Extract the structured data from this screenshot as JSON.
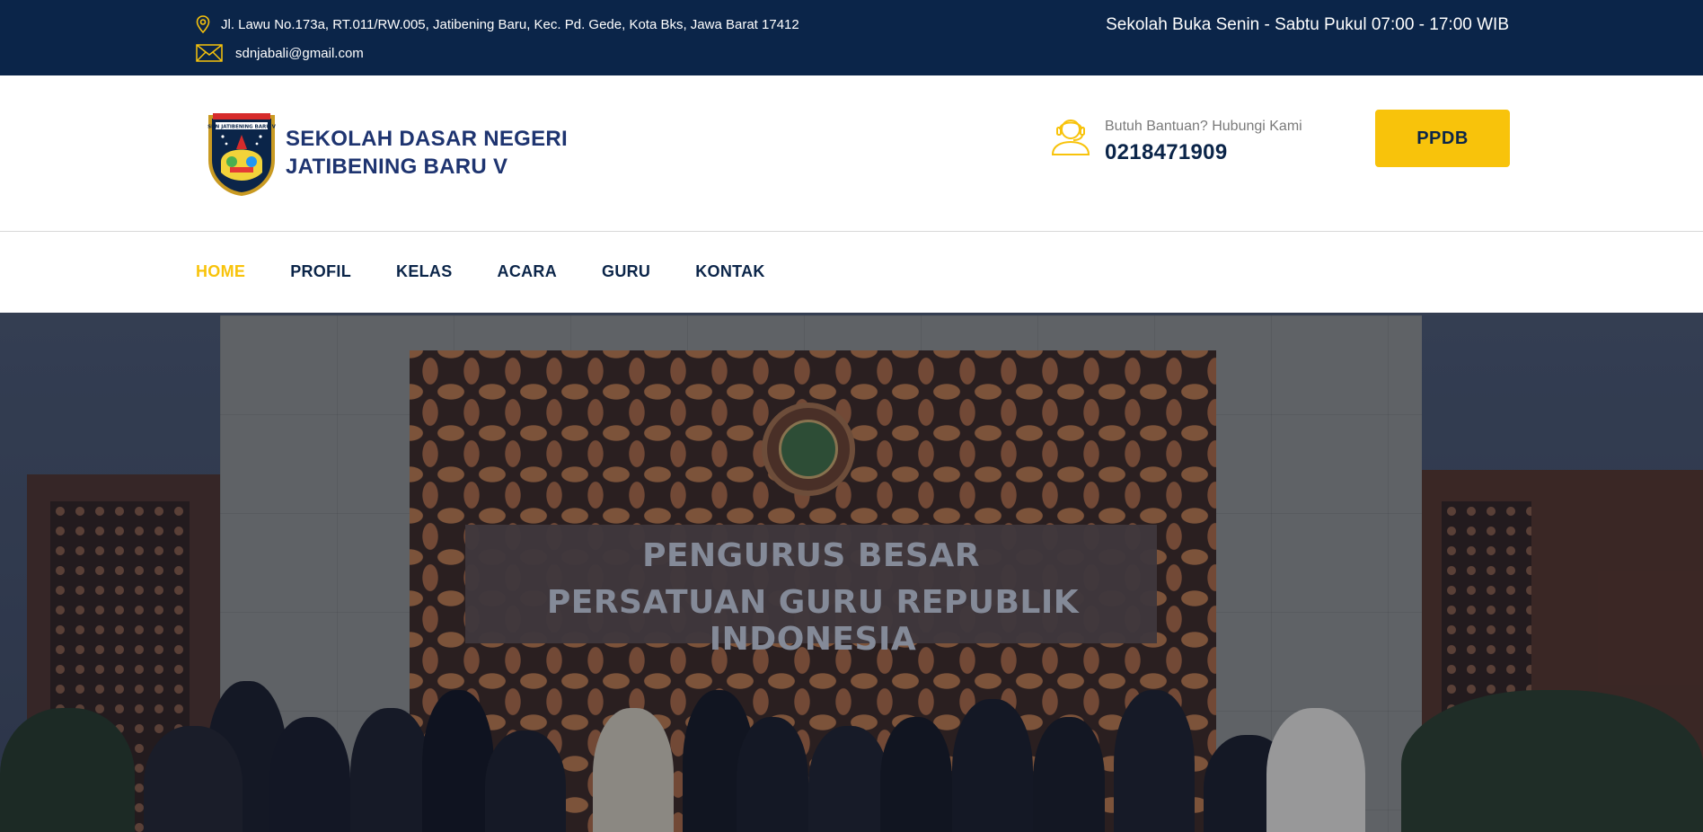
{
  "topbar": {
    "address": "Jl. Lawu No.173a, RT.011/RW.005, Jatibening Baru, Kec. Pd. Gede, Kota Bks, Jawa Barat 17412",
    "email": "sdnjabali@gmail.com",
    "hours": "Sekolah Buka Senin - Sabtu Pukul 07:00 - 17:00 WIB",
    "icons": {
      "address": "map-pin-icon",
      "email": "envelope-icon"
    }
  },
  "header": {
    "logo_line1": "SEKOLAH DASAR NEGERI",
    "logo_line2": "JATIBENING BARU V",
    "logo_badge_text": "SDN JATIBENING BARU V",
    "help_label": "Butuh Bantuan? Hubungi Kami",
    "help_phone": "0218471909",
    "help_icon": "headset-icon",
    "ppdb_label": "PPDB"
  },
  "nav": {
    "items": [
      {
        "label": "HOME",
        "active": true
      },
      {
        "label": "PROFIL",
        "active": false
      },
      {
        "label": "KELAS",
        "active": false
      },
      {
        "label": "ACARA",
        "active": false
      },
      {
        "label": "GURU",
        "active": false
      },
      {
        "label": "KONTAK",
        "active": false
      }
    ]
  },
  "hero": {
    "plaque_line1": "PENGURUS BESAR",
    "plaque_line2": "PERSATUAN GURU REPUBLIK INDONESIA"
  },
  "colors": {
    "navy": "#0b2549",
    "accent_yellow": "#f8c30b",
    "logo_blue": "#1e3470"
  }
}
